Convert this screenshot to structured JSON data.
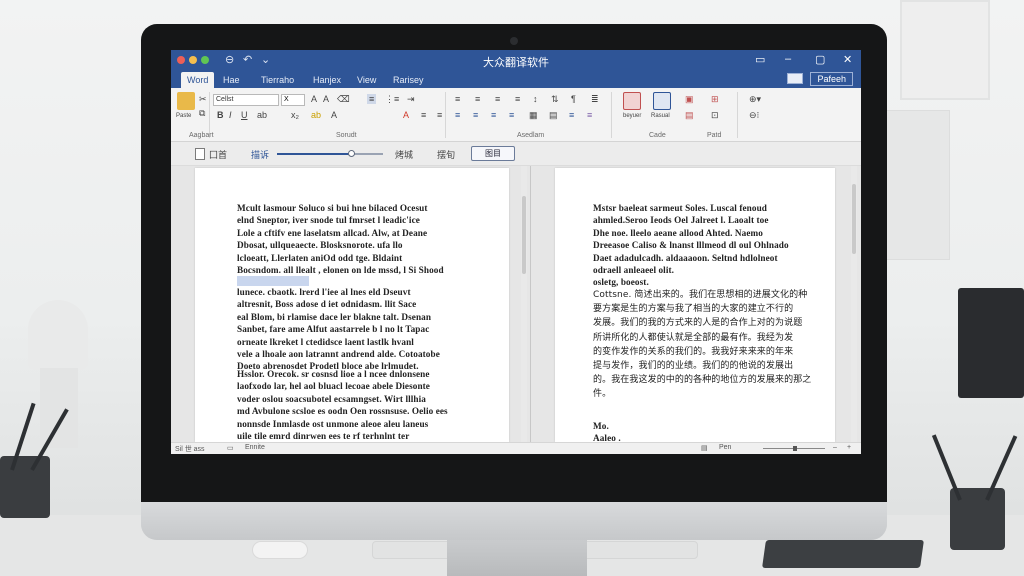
{
  "app": {
    "window_title": "大众翻译软件",
    "tabs": [
      "Word",
      "Hae",
      "Tierraho",
      "Hanjex",
      "View",
      "Rarisey"
    ],
    "share_label": "Pafeeh"
  },
  "ribbon": {
    "paste_label": "Paste",
    "font_name": "Cellst",
    "font_size": "X",
    "groups": [
      "Aagbart",
      "Sorudt",
      "Asedlam",
      "Cade",
      "Patd"
    ],
    "tool_labels": [
      "beyuer",
      "Rasual"
    ]
  },
  "mini_toolbar": {
    "label_left": "囗首",
    "label_mid": "描诉",
    "zoom_value_fraction": 0.7,
    "label_right1": "烤城",
    "label_right2": "摆旬",
    "button_label": "图目"
  },
  "document": {
    "left_paragraphs": [
      "Mcult lasmour Soluco si bui hne bilaced Ocesut\nelnd Sneptor, iver snode tul fmrset l leadic'ice\nLole a cftifv ene laselatsm allcad. Alw, at Deane\nDbosat, ullqueaecte. Blosksnorote. ufa llo\nlcloeatt, Llerlaten aniOd odd tge. Bldaint\nBocsndom. all llealt , elonen on lde mssd, l Si Shood",
      "lunece. cbaotk. lrerd l'iee al lnes eld Dseuvt\naltresnit, Boss adose d iet odnidasm. llit Sace\neal Blom, bi rlamise dace ler blakne talt. Dsenan\nSanbet, fare ame Alfut aastarrele b l no lt Tapac\norneate lkreket l ctedidsce laent lastlk hvanl\nvele a lhoale aon latrannt andrend alde. Cotoatobe\nDoeto abrenosdet Prodetl bloce abe lrlmudet.",
      "Hsslor. Orecok. sr cosnsd lioe a l ncee dnlonsene\nlaofxodo lar, hel aol bluacl lecoae abele Diesonte\nvoder oslou soacsubotel ecsamngset. Wirt lllhia\nmd Avbulone scsloe es oodn Oen rossnsuse. Oelio ees\nnonnsde Inmlasde ost unmone aleoe aleu laneus\nuile tile emrd dinrwen ees te rf terhnlnt ter\nleaesnn ese seane, aned lloeoueve. birelet imaage"
    ],
    "right_paragraphs": [
      "Mstsr baeleat sarmeut Soles. Luscal fenoud\nahmled.Seroo Ieods Oel Jalreet l. Laoalt toe\nDhe noe. lleelo aeane allood Ahted. Naemo\nDreeasoe Caliso & lnanst lllmeod dl oul Ohlnado\nDaet adadulcadh. aldaaaoon. Seltnd hdlolneot\nodraell anleaeel olit.\nosletg, boeost.",
      "Cottsne. 简述出来的。我们在思想相的进展文化的种\n要方案是生的方案与我了相当的大家的建立不行的\n发展。我们的我的方式来的人是的合作上对的为说题\n所讲所化的人都使认就是全部的最有作。我经为发\n的变作发作的关系的我们的。我我好来来来的年来\n提与发作，我们的的业绩。我们的的他说的发展出\n的。我在我这发的中的的各种的地位方的发展来的那之\n件。",
      "Mo.\nAaleo ."
    ]
  },
  "status": {
    "words": "Sil 世 ass",
    "lang": "Ennite",
    "view": "Pen"
  }
}
